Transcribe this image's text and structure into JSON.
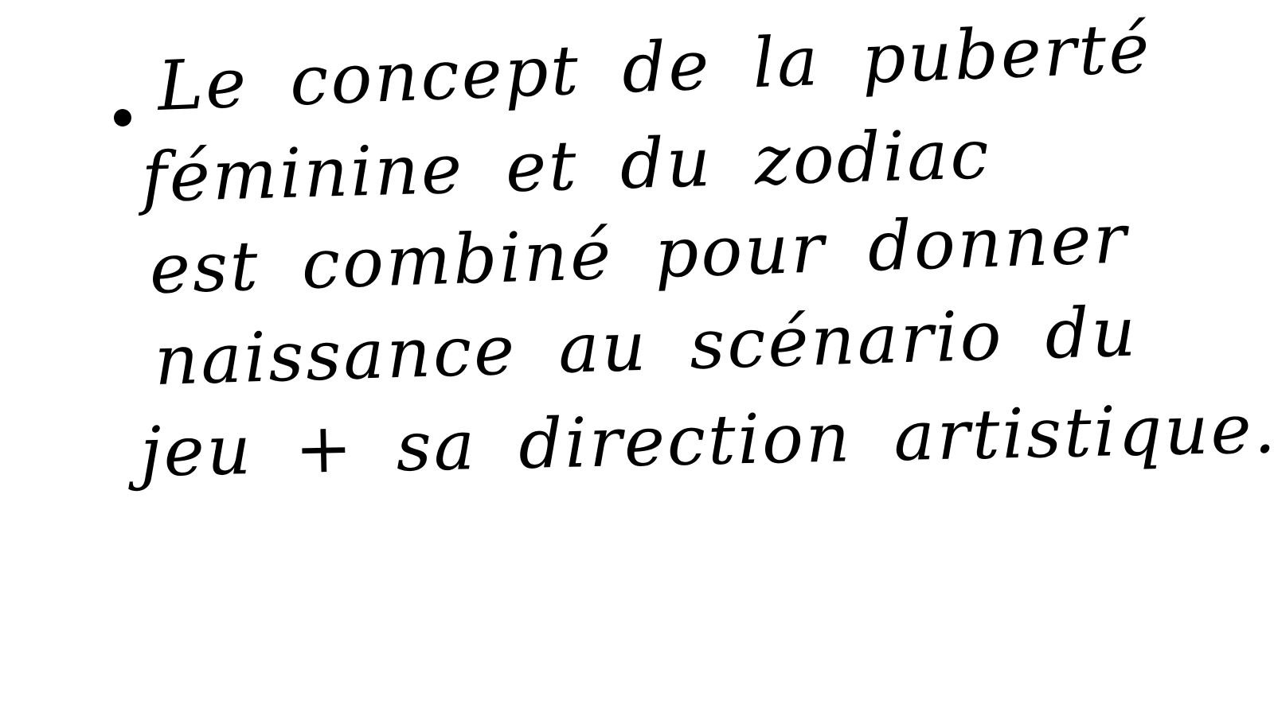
{
  "note": {
    "lines": [
      "Le concept de la puberté",
      "féminine et du zodiac",
      "est combiné pour donner",
      "naissance au scénario du",
      "jeu + sa direction artistique."
    ]
  }
}
